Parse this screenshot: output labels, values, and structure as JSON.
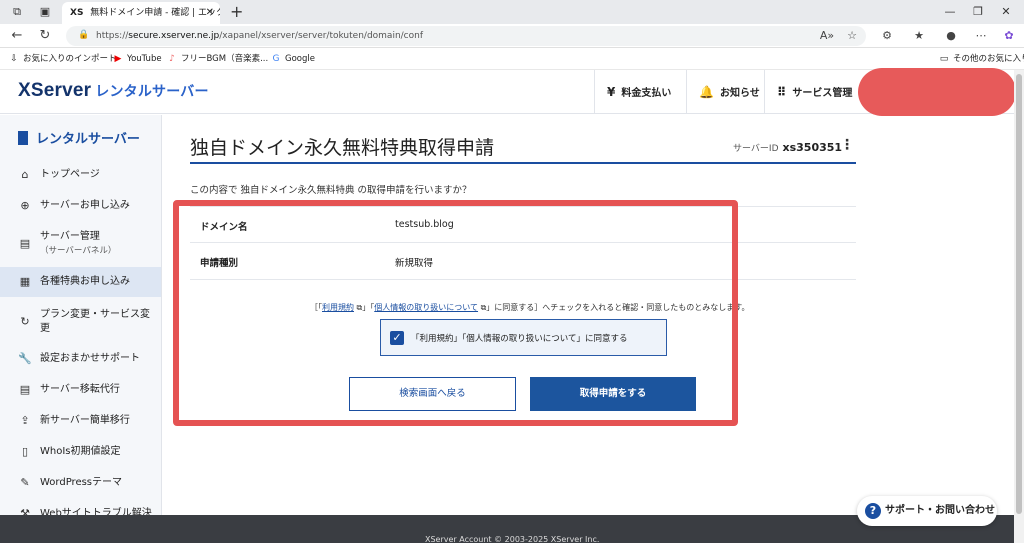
{
  "browser": {
    "tab_title": "無料ドメイン申請 - 確認 | エックスサ",
    "tab_favicon": "XS",
    "url_prefix": "https://",
    "url_host": "secure.xserver.ne.jp",
    "url_path": "/xapanel/xserver/server/tokuten/domain/conf",
    "bookmarks": [
      "お気に入りのインポート",
      "YouTube",
      "フリーBGM（音楽素...",
      "Google"
    ],
    "other_bookmarks": "その他のお気に入り"
  },
  "header": {
    "logo": "XServer",
    "logo_sub": "レンタルサーバー",
    "payment": "料金支払い",
    "notice": "お知らせ",
    "service": "サービス管理"
  },
  "sidebar": {
    "title": "レンタルサーバー",
    "items": [
      {
        "label": "トップページ",
        "icon": "home-icon"
      },
      {
        "label": "サーバーお申し込み",
        "icon": "plus-circle-icon"
      },
      {
        "label": "サーバー管理",
        "sub": "（サーバーパネル）",
        "icon": "server-icon"
      },
      {
        "label": "各種特典お申し込み",
        "icon": "gift-icon"
      },
      {
        "label": "プラン変更・サービス変更",
        "icon": "refresh-icon"
      },
      {
        "label": "設定おまかせサポート",
        "icon": "wrench-icon"
      },
      {
        "label": "サーバー移転代行",
        "icon": "server-move-icon"
      },
      {
        "label": "新サーバー簡単移行",
        "icon": "upload-icon"
      },
      {
        "label": "WhoIs初期値設定",
        "icon": "document-icon"
      },
      {
        "label": "WordPressテーマ",
        "icon": "edit-icon"
      },
      {
        "label": "Webサイトトラブル解決",
        "icon": "tool-icon"
      }
    ]
  },
  "main": {
    "title": "独自ドメイン永久無料特典取得申請",
    "server_id_label": "サーバーID",
    "server_id": "xs350351",
    "question": "この内容で 独自ドメイン永久無料特典 の取得申請を行いますか？",
    "rows": [
      {
        "key": "ドメイン名",
        "value": "testsub.blog"
      },
      {
        "key": "申請種別",
        "value": "新規取得"
      }
    ],
    "terms_open": "［「",
    "terms_link1": "利用規約",
    "terms_mid": "」「",
    "terms_link2": "個人情報の取り扱いについて",
    "terms_rest": "」に同意する］へチェックを入れると確認・同意したものとみなします。",
    "agree_label": "「利用規約」「個人情報の取り扱いについて」に同意する",
    "back_button": "検索画面へ戻る",
    "apply_button": "取得申請をする"
  },
  "support": "サポート・お問い合わせ",
  "footer": "XServer Account © 2003-2025 XServer Inc.",
  "colors": {
    "brand": "#1a4ea0",
    "highlight": "#e55353"
  }
}
